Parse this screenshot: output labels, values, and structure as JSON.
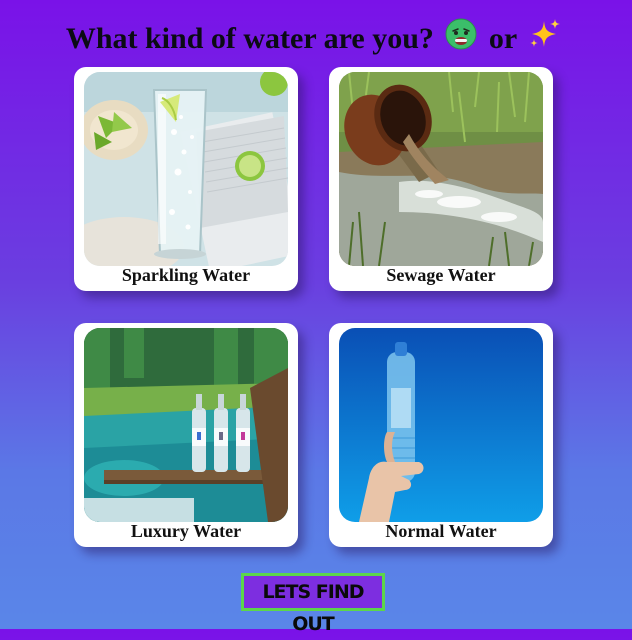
{
  "header": {
    "title_part1": "What kind of water are you?",
    "title_part2": "or",
    "emoji_1": "sick-face-emoji",
    "emoji_2": "sparkles-emoji"
  },
  "cards": [
    {
      "label": "Sparkling Water",
      "image": "sparkling-water-glass-photo"
    },
    {
      "label": "Sewage Water",
      "image": "sewage-pipe-photo"
    },
    {
      "label": "Luxury Water",
      "image": "luxury-water-bottles-photo"
    },
    {
      "label": "Normal Water",
      "image": "water-bottle-hand-photo"
    }
  ],
  "cta": {
    "label": "LETS FIND OUT"
  },
  "colors": {
    "background_top": "#7a12e8",
    "background_bottom": "#5a86e8",
    "button_fill": "#7d2ee0",
    "button_border": "#5cd64a"
  }
}
